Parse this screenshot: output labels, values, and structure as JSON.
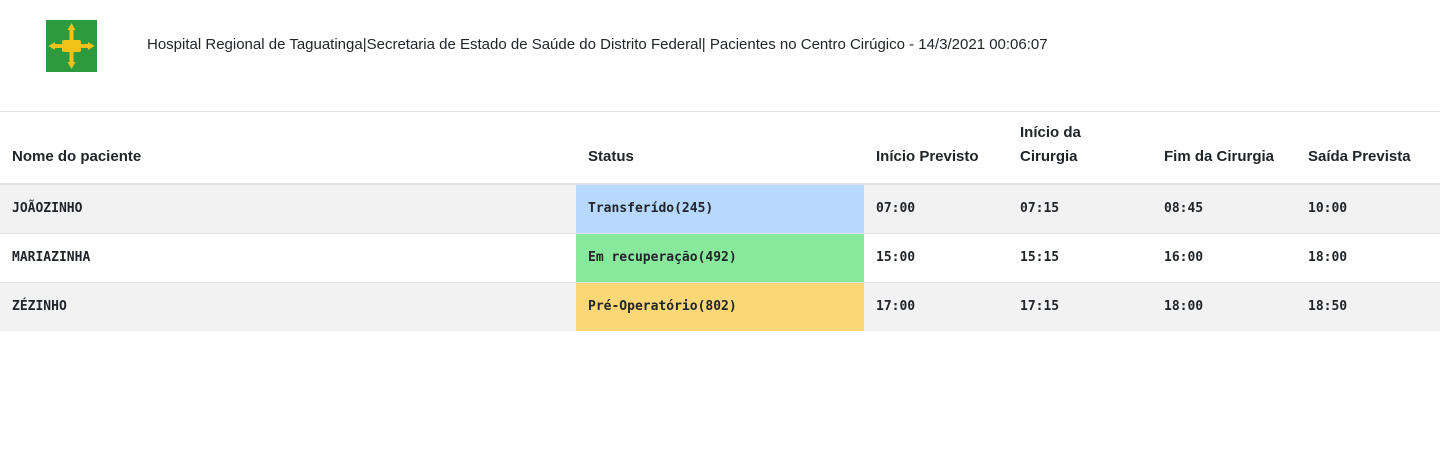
{
  "header": {
    "title": "Hospital Regional de Taguatinga|Secretaria de Estado de Saúde do Distrito Federal| Pacientes no Centro Cirúgico - 14/3/2021 00:06:07",
    "logo_colors": {
      "green": "#2e9a3e",
      "yellow": "#f2c21b"
    }
  },
  "table": {
    "columns": [
      "Nome do paciente",
      "Status",
      "Início Previsto",
      "Início da Cirurgia",
      "Fim da Cirurgia",
      "Saída Prevista"
    ],
    "rows": [
      {
        "name": "JOÃOZINHO",
        "status": "Transferído(245)",
        "status_color": "#b7d9ff",
        "inicio_previsto": "07:00",
        "inicio_cirurgia": "07:15",
        "fim_cirurgia": "08:45",
        "saida_prevista": "10:00"
      },
      {
        "name": "MARIAZINHA",
        "status": "Em recuperação(492)",
        "status_color": "#88e89c",
        "inicio_previsto": "15:00",
        "inicio_cirurgia": "15:15",
        "fim_cirurgia": "16:00",
        "saida_prevista": "18:00"
      },
      {
        "name": "ZÉZINHO",
        "status": "Pré-Operatório(802)",
        "status_color": "#fbd776",
        "inicio_previsto": "17:00",
        "inicio_cirurgia": "17:15",
        "fim_cirurgia": "18:00",
        "saida_prevista": "18:50"
      }
    ]
  }
}
